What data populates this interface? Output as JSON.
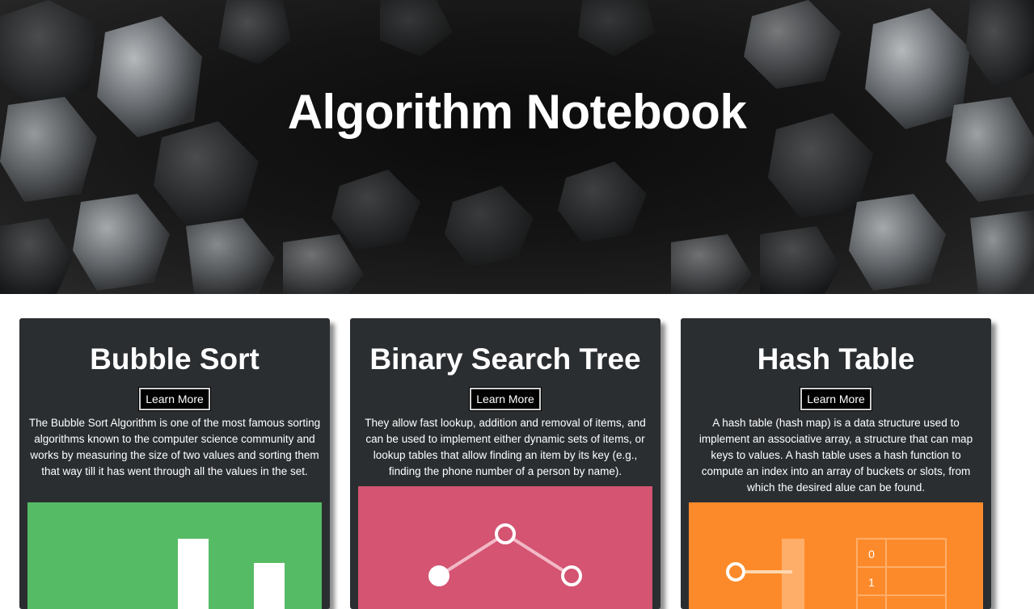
{
  "header": {
    "title": "Algorithm Notebook"
  },
  "cards": [
    {
      "title": "Bubble Sort",
      "button_label": "Learn More",
      "description": "The Bubble Sort Algorithm is one of the most famous sorting algorithms known to the computer science community and works by measuring the size of two values and sorting them that way till it has went through all the values in the set.",
      "accent": "#56bb65"
    },
    {
      "title": "Binary Search Tree",
      "button_label": "Learn More",
      "description": "They allow fast lookup, addition and removal of items, and can be used to implement either dynamic sets of items, or lookup tables that allow finding an item by its key (e.g., finding the phone number of a person by name).",
      "accent": "#d45472"
    },
    {
      "title": "Hash Table",
      "button_label": "Learn More",
      "description": "A hash table (hash map) is a data structure used to implement an associative array, a structure that can map keys to values. A hash table uses a hash function to compute an index into an array of buckets or slots, from which the desired alue can be found.",
      "accent": "#fd8a2a",
      "bucket_labels": [
        "0",
        "1"
      ]
    }
  ]
}
